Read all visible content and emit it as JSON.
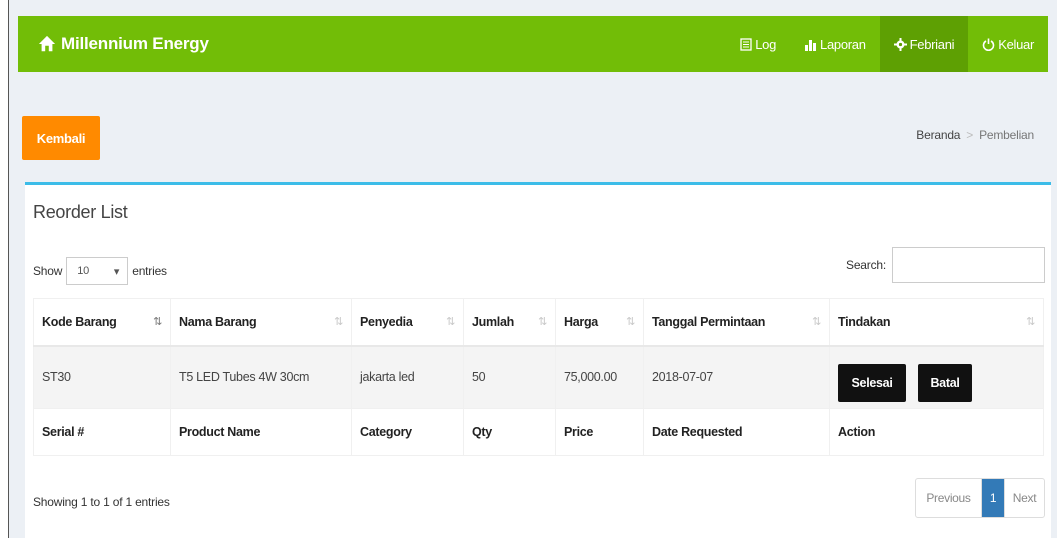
{
  "brand": {
    "name": "Millennium Energy",
    "icon": "home-icon"
  },
  "nav": {
    "log": "Log",
    "laporan": "Laporan",
    "user": "Febriani",
    "keluar": "Keluar"
  },
  "back_button": "Kembali",
  "breadcrumb": {
    "home": "Beranda",
    "current": "Pembelian"
  },
  "box": {
    "title": "Reorder List"
  },
  "controls": {
    "show": "Show",
    "entries_value": "10",
    "entries": "entries",
    "search": "Search:"
  },
  "table": {
    "headers": [
      "Kode Barang",
      "Nama Barang",
      "Penyedia",
      "Jumlah",
      "Harga",
      "Tanggal Permintaan",
      "Tindakan"
    ],
    "rows": [
      [
        "ST30",
        "T5 LED Tubes 4W 30cm",
        "jakarta led",
        "50",
        "75,000.00",
        "2018-07-07"
      ]
    ],
    "actions": {
      "done": "Selesai",
      "cancel": "Batal"
    },
    "footers": [
      "Serial #",
      "Product Name",
      "Category",
      "Qty",
      "Price",
      "Date Requested",
      "Action"
    ]
  },
  "info": "Showing 1 to 1 of 1 entries",
  "pagination": {
    "previous": "Previous",
    "page": "1",
    "next": "Next"
  },
  "colors": {
    "navbar": "#72bd07",
    "navbar_active": "#5ea003",
    "back_button": "#ff8a00",
    "box_border": "#3cbce8",
    "page_active": "#337ab7"
  }
}
